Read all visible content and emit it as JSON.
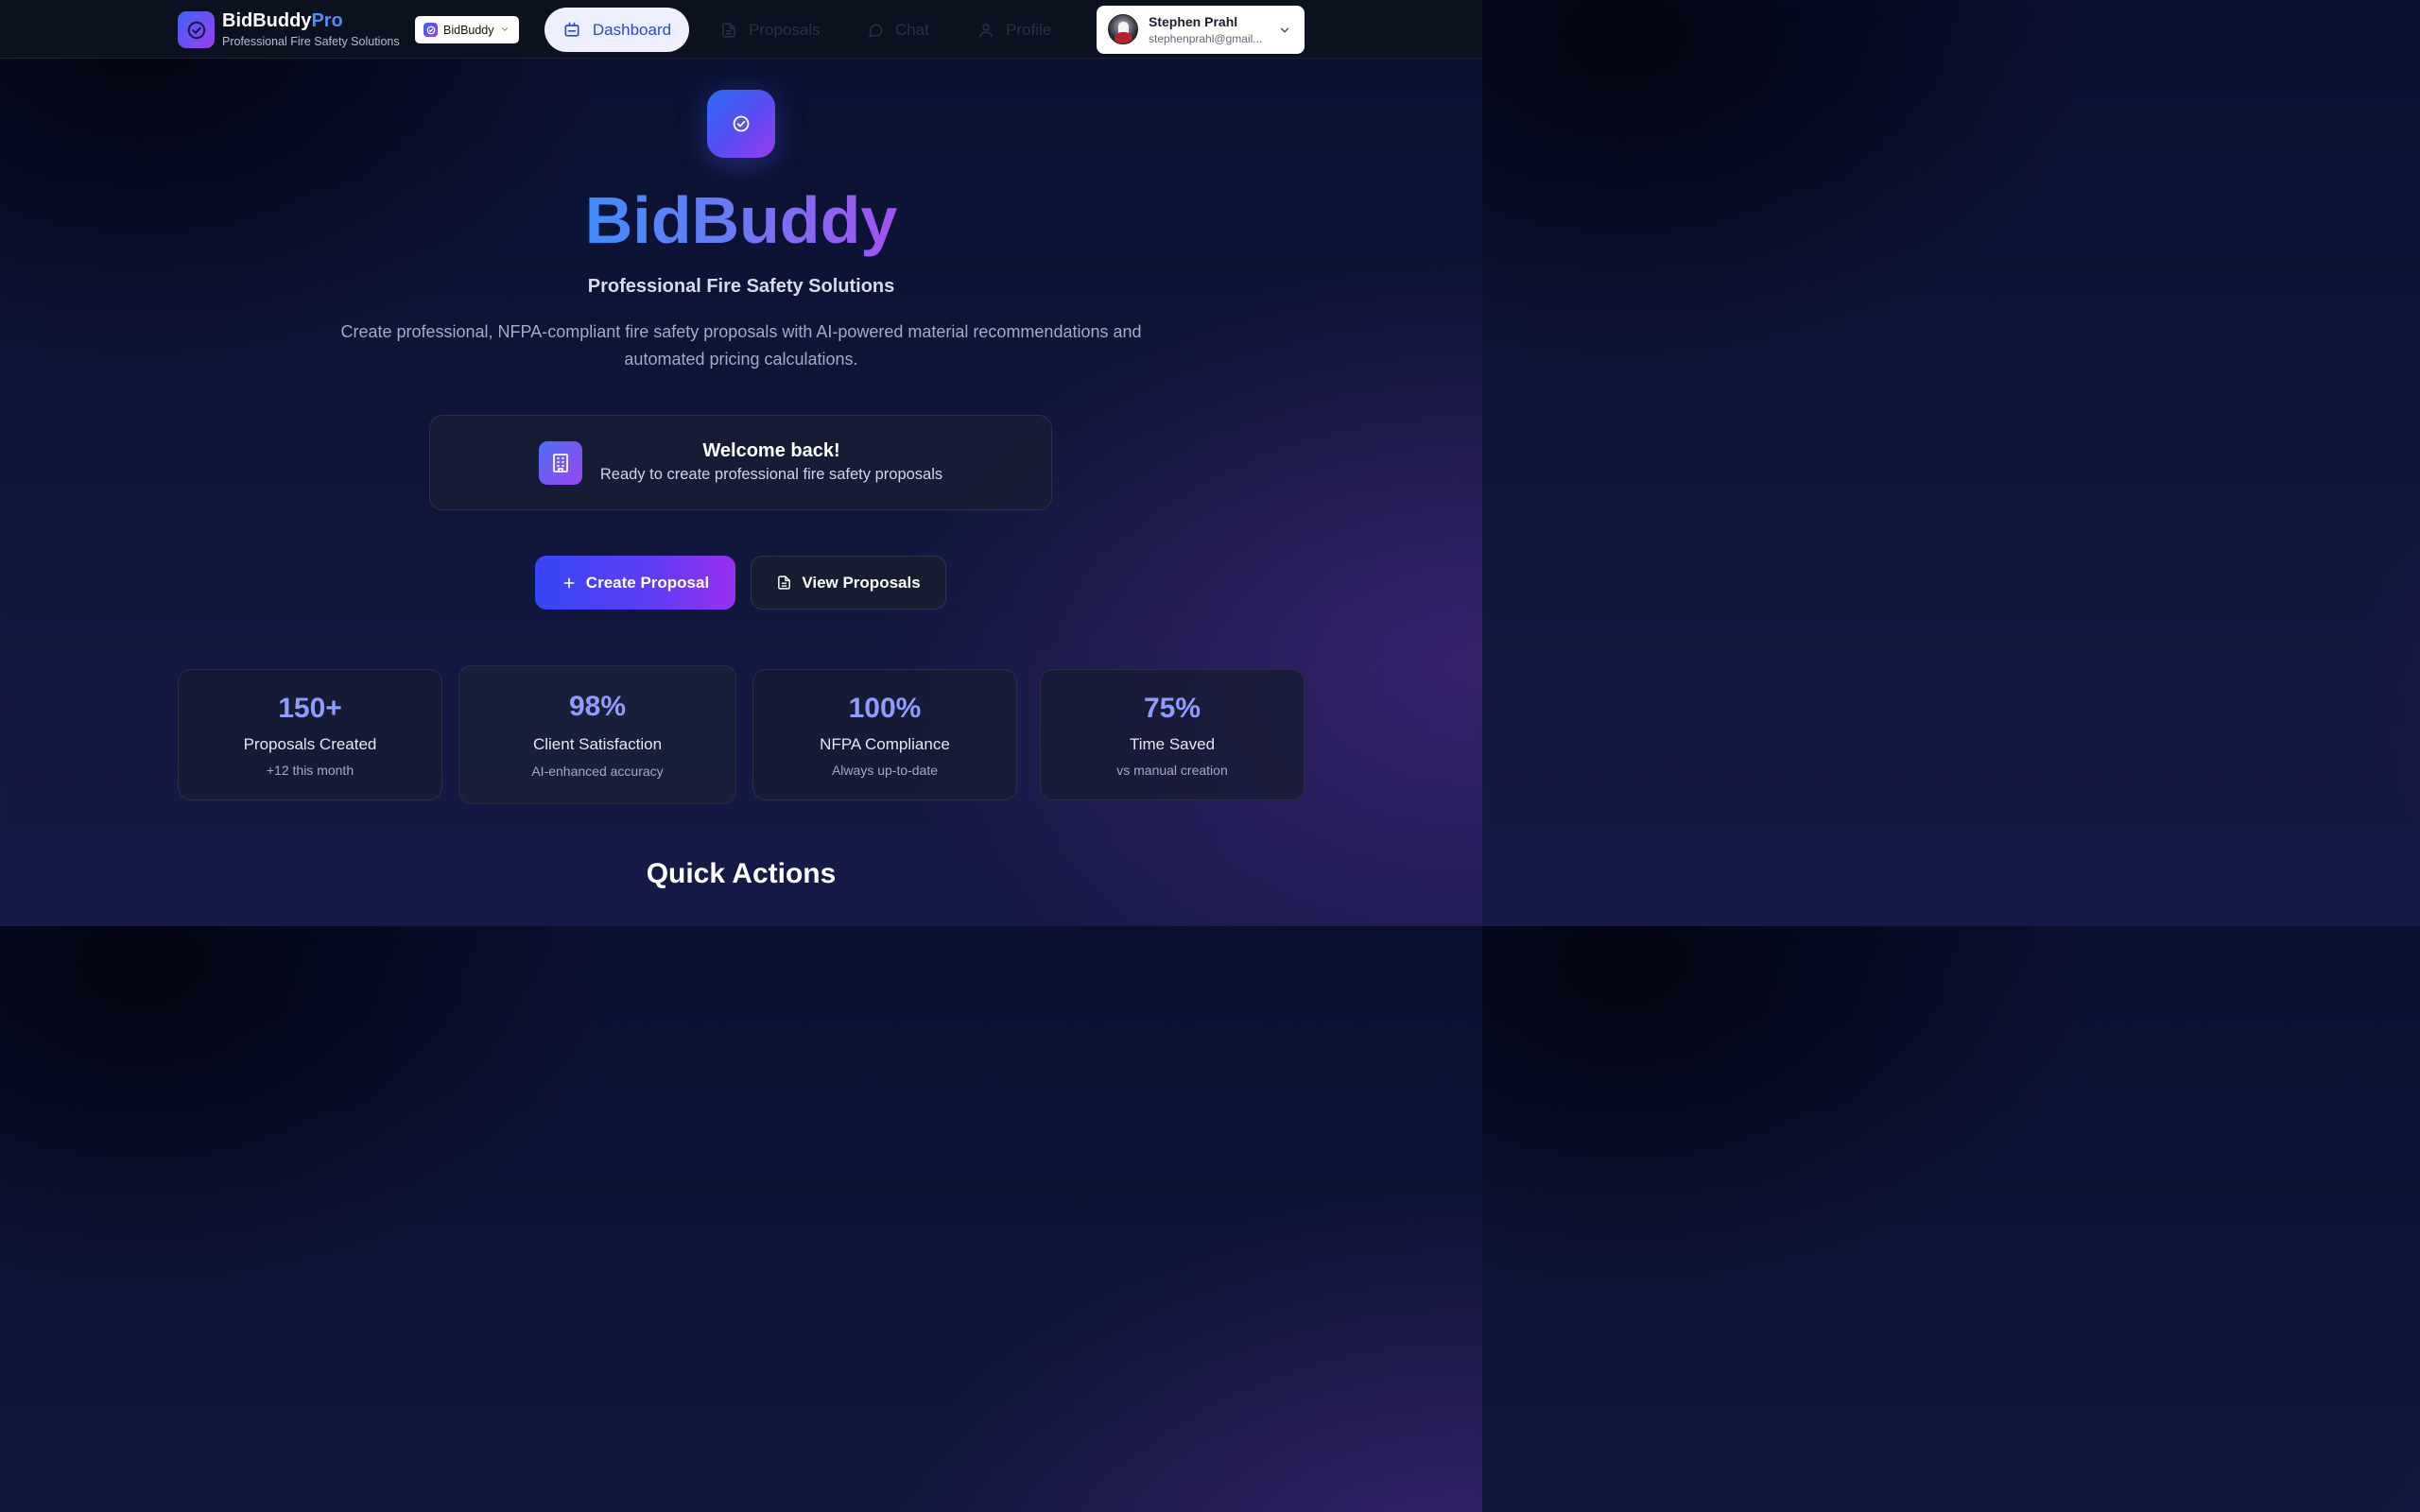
{
  "nav": {
    "brand_name": "BidBuddy",
    "brand_suffix": "Pro",
    "brand_tagline": "Professional Fire Safety Solutions",
    "app_switch_label": "BidBuddy",
    "tabs": [
      {
        "label": "Dashboard",
        "icon": "dashboard-icon",
        "active": true
      },
      {
        "label": "Proposals",
        "icon": "document-icon",
        "active": false
      },
      {
        "label": "Chat",
        "icon": "chat-icon",
        "active": false
      },
      {
        "label": "Profile",
        "icon": "user-icon",
        "active": false
      }
    ],
    "user": {
      "name": "Stephen Prahl",
      "email": "stephenprahl@gmail..."
    }
  },
  "hero": {
    "title": "BidBuddy",
    "subtitle": "Professional Fire Safety Solutions",
    "description": "Create professional, NFPA-compliant fire safety proposals with AI-powered material recommendations and automated pricing calculations."
  },
  "welcome": {
    "title": "Welcome back!",
    "text": "Ready to create professional fire safety proposals",
    "icon": "building-icon"
  },
  "actions": {
    "primary": "Create Proposal",
    "secondary": "View Proposals"
  },
  "stats": [
    {
      "value": "150+",
      "label": "Proposals Created",
      "note": "+12 this month"
    },
    {
      "value": "98%",
      "label": "Client Satisfaction",
      "note": "AI-enhanced accuracy"
    },
    {
      "value": "100%",
      "label": "NFPA Compliance",
      "note": "Always up-to-date"
    },
    {
      "value": "75%",
      "label": "Time Saved",
      "note": "vs manual creation"
    }
  ],
  "quick_actions_title": "Quick Actions",
  "colors": {
    "accent_blue": "#4d8cff",
    "accent_purple": "#9a3cf0",
    "stat_value": "#8f9cff",
    "active_tab_bg": "#eef0ff",
    "active_tab_text": "#2f45d8"
  }
}
